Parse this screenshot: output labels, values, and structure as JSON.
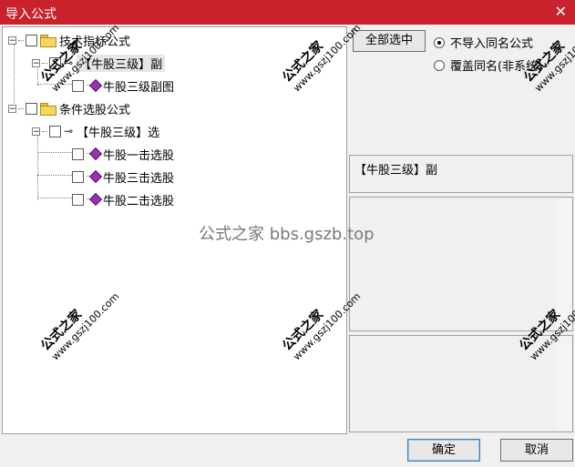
{
  "window": {
    "title": "导入公式",
    "close_glyph": "✕"
  },
  "tree": {
    "group1": {
      "label": "技术指标公式"
    },
    "item1": {
      "label": "【牛股三级】副"
    },
    "item1_child": {
      "label": "牛股三级副图"
    },
    "group2": {
      "label": "条件选股公式"
    },
    "item2": {
      "label": "【牛股三级】选"
    },
    "item2_children": [
      "牛股一击选股",
      "牛股三击选股",
      "牛股二击选股"
    ]
  },
  "controls": {
    "select_all": "全部选中",
    "radio_skip": "不导入同名公式",
    "radio_overwrite": "覆盖同名(非系统)",
    "ok": "确定",
    "cancel": "取消"
  },
  "description": "【牛股三级】副",
  "watermark": {
    "center": "公式之家 bbs.gszb.top",
    "stamp_big": "公式之家",
    "stamp_url": "www.gszj100.com"
  },
  "colors": {
    "titlebar": "#c8232c",
    "gem": "#9b2fb5"
  }
}
